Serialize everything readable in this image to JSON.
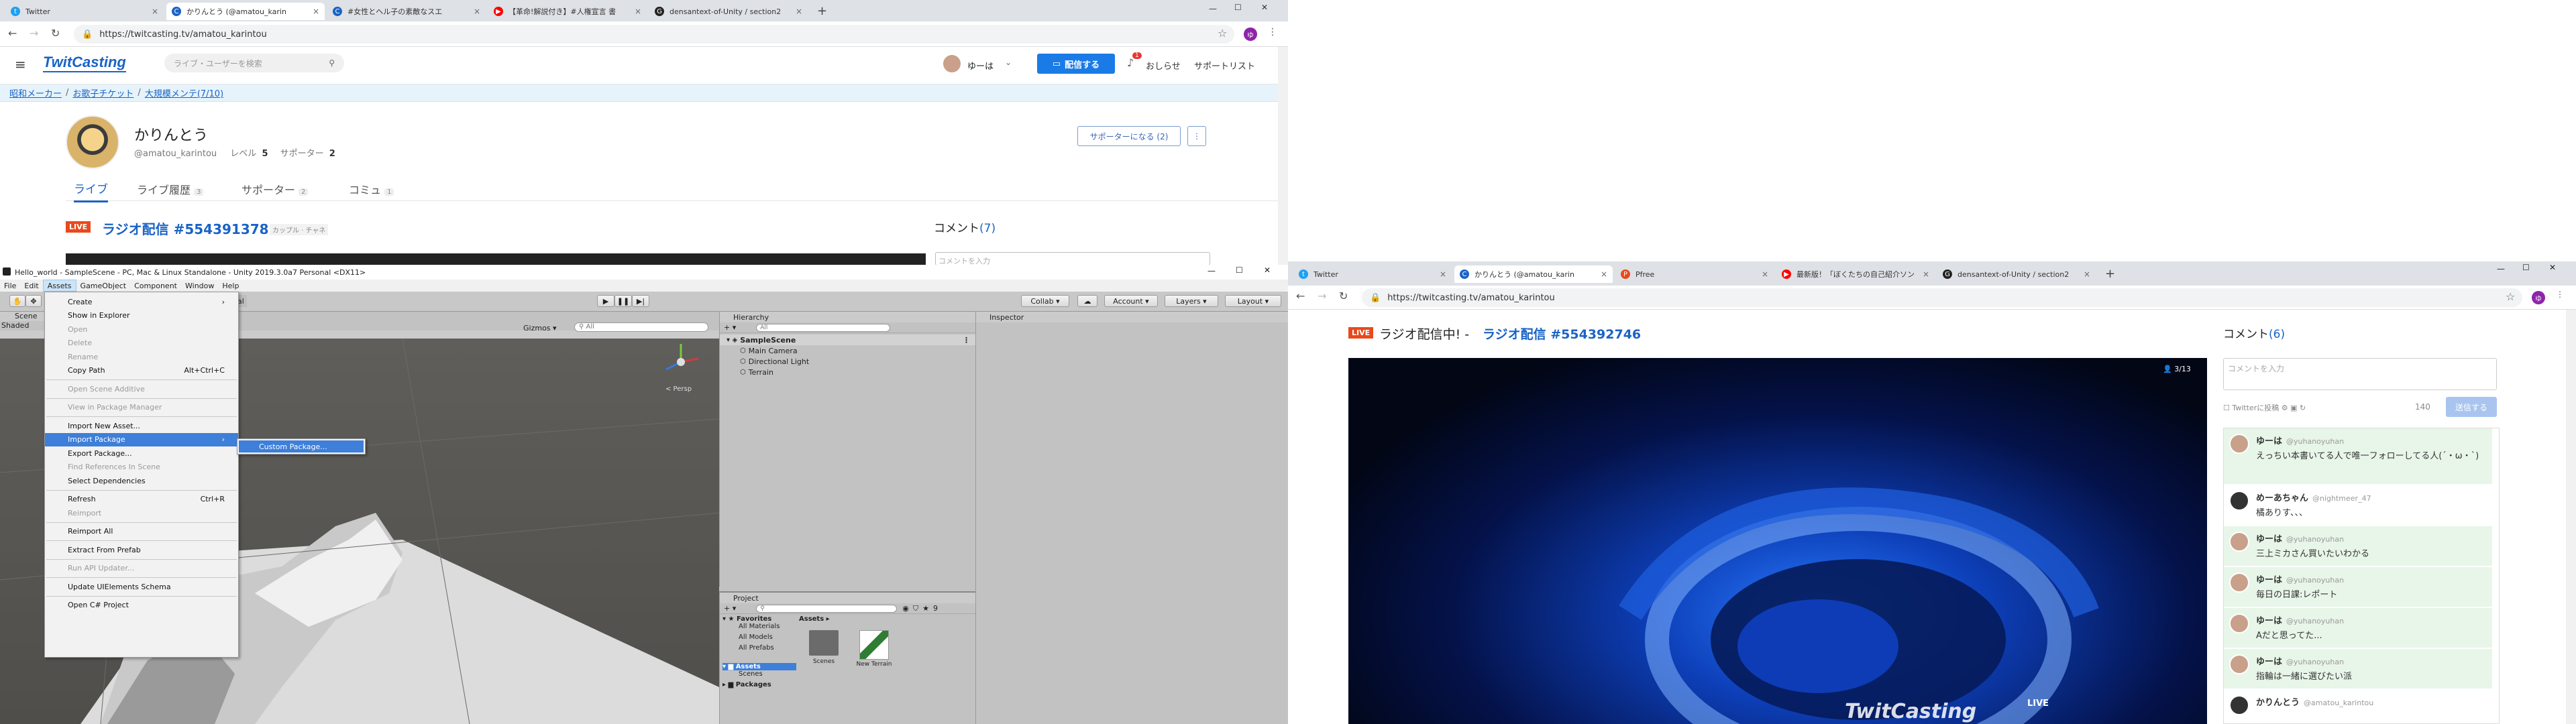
{
  "left_browser": {
    "tabs": [
      {
        "label": "Twitter",
        "icon": "twitter-icon"
      },
      {
        "label": "かりんとう (@amatou_karin",
        "icon": "twitcasting-icon"
      },
      {
        "label": "#女性とヘル子の素敵なスエ",
        "icon": "twitcasting-icon"
      },
      {
        "label": "【革命!解説付き】#人権宣言 書",
        "icon": "youtube-icon"
      },
      {
        "label": "densantext-of-Unity / section2",
        "icon": "github-icon"
      }
    ],
    "url": "https://twitcasting.tv/amatou_karintou",
    "site": {
      "logo": "TwitCasting",
      "search_placeholder": "ライブ・ユーザーを検索",
      "user_name": "ゆーは",
      "broadcast_button": "配信する",
      "notifications_label": "おしらせ",
      "notification_count": "1",
      "supporter_list": "サポートリスト",
      "banner": [
        "昭和メーカー",
        "お歌子チケット",
        "大規模メンテ(7/10)"
      ],
      "profile_name": "かりんとう",
      "profile_handle": "@amatou_karintou",
      "level_label": "レベル",
      "level_value": "5",
      "supporter_label": "サポーター",
      "supporter_value": "2",
      "become_supporter": "サポーターになる (2)",
      "tabs": [
        {
          "label": "ライブ",
          "count": ""
        },
        {
          "label": "ライブ履歴",
          "count": "3"
        },
        {
          "label": "サポーター",
          "count": "2"
        },
        {
          "label": "コミュ",
          "count": "1"
        }
      ],
      "live_badge": "LIVE",
      "live_title": "ラジオ配信 #554391378",
      "live_tags": "カップル · チャネ",
      "comment_header": "コメント",
      "comment_count": "(7)",
      "comment_placeholder": "コメントを入力"
    }
  },
  "unity": {
    "title": "Hello_world - SampleScene - PC, Mac & Linux Standalone - Unity 2019.3.0a7 Personal <DX11>",
    "menubar": [
      "File",
      "Edit",
      "Assets",
      "GameObject",
      "Component",
      "Window",
      "Help"
    ],
    "assets_menu": [
      {
        "label": "Create",
        "shortcut": "",
        "disabled": false,
        "submenu": true
      },
      {
        "label": "Show in Explorer",
        "shortcut": "",
        "disabled": false
      },
      {
        "label": "Open",
        "shortcut": "",
        "disabled": true
      },
      {
        "label": "Delete",
        "shortcut": "",
        "disabled": true
      },
      {
        "label": "Rename",
        "shortcut": "",
        "disabled": true
      },
      {
        "label": "Copy Path",
        "shortcut": "Alt+Ctrl+C",
        "disabled": false
      },
      {
        "sep": true
      },
      {
        "label": "Open Scene Additive",
        "shortcut": "",
        "disabled": true
      },
      {
        "sep": true
      },
      {
        "label": "View in Package Manager",
        "shortcut": "",
        "disabled": true
      },
      {
        "sep": true
      },
      {
        "label": "Import New Asset...",
        "shortcut": "",
        "disabled": false
      },
      {
        "label": "Import Package",
        "shortcut": "",
        "disabled": false,
        "submenu": true,
        "highlighted": true
      },
      {
        "label": "Export Package...",
        "shortcut": "",
        "disabled": false
      },
      {
        "label": "Find References In Scene",
        "shortcut": "",
        "disabled": true
      },
      {
        "label": "Select Dependencies",
        "shortcut": "",
        "disabled": false
      },
      {
        "sep": true
      },
      {
        "label": "Refresh",
        "shortcut": "Ctrl+R",
        "disabled": false
      },
      {
        "label": "Reimport",
        "shortcut": "",
        "disabled": true
      },
      {
        "sep": true
      },
      {
        "label": "Reimport All",
        "shortcut": "",
        "disabled": false
      },
      {
        "sep": true
      },
      {
        "label": "Extract From Prefab",
        "shortcut": "",
        "disabled": false
      },
      {
        "sep": true
      },
      {
        "label": "Run API Updater...",
        "shortcut": "",
        "disabled": true
      },
      {
        "sep": true
      },
      {
        "label": "Update UIElements Schema",
        "shortcut": "",
        "disabled": false
      },
      {
        "sep": true
      },
      {
        "label": "Open C# Project",
        "shortcut": "",
        "disabled": false
      }
    ],
    "submenu_item": "Custom Package...",
    "scene_tab": "Scene",
    "shaded": "Shaded",
    "gizmos": "Gizmos",
    "persp": "< Persp",
    "collab": "Collab",
    "account": "Account",
    "layers": "Layers",
    "layout": "Layout",
    "hierarchy_tab": "Hierarchy",
    "hierarchy_search": "All",
    "hierarchy": [
      {
        "label": "SampleScene",
        "indent": 0,
        "scene": true
      },
      {
        "label": "Main Camera",
        "indent": 1
      },
      {
        "label": "Directional Light",
        "indent": 1
      },
      {
        "label": "Terrain",
        "indent": 1
      }
    ],
    "inspector_tab": "Inspector",
    "project_tab": "Project",
    "favorites": "Favorites",
    "favorites_items": [
      "All Materials",
      "All Models",
      "All Prefabs"
    ],
    "assets_root": "Assets",
    "assets_children": [
      "Scenes",
      "Packages"
    ],
    "assets_breadcrumb": "Assets",
    "asset_items": [
      {
        "label": "Scenes",
        "icon": "folder-icon"
      },
      {
        "label": "New Terrain",
        "icon": "terrain-icon"
      }
    ],
    "counter": "9",
    "game_tab": "al"
  },
  "right_browser": {
    "tabs": [
      {
        "label": "Twitter",
        "icon": "twitter-icon"
      },
      {
        "label": "かりんとう (@amatou_karin",
        "icon": "twitcasting-icon"
      },
      {
        "label": "Pfree",
        "icon": "pfree-icon"
      },
      {
        "label": "最新版！「ぼくたちの自己紹介ソン",
        "icon": "youtube-icon"
      },
      {
        "label": "densantext-of-Unity / section2",
        "icon": "github-icon"
      }
    ],
    "url": "https://twitcasting.tv/amatou_karintou",
    "live_badge": "LIVE",
    "live_prefix": "ラジオ配信中! -",
    "live_title": "ラジオ配信 #554392746",
    "viewer_count": "3/13",
    "comment_header": "コメント",
    "comment_count": "(6)",
    "comment_placeholder": "コメントを入力",
    "twitter_post": "Twitterに投稿",
    "char_count": "140",
    "submit": "送信する",
    "video_watermark": "TwitCasting",
    "video_live": "LIVE",
    "comments": [
      {
        "name": "ゆーは",
        "handle": "@yuhanoyuhan",
        "text": "えっちい本書いてる人で唯一フォローしてる人(´・ω・`)",
        "green": true
      },
      {
        "name": "めーあちゃん",
        "handle": "@nightmeer_47",
        "text": "橘ありす、、、",
        "green": false
      },
      {
        "name": "ゆーは",
        "handle": "@yuhanoyuhan",
        "text": "三上ミカさん買いたいわかる",
        "green": true
      },
      {
        "name": "ゆーは",
        "handle": "@yuhanoyuhan",
        "text": "毎日の日課:レポート",
        "green": true
      },
      {
        "name": "ゆーは",
        "handle": "@yuhanoyuhan",
        "text": "Aだと思ってた...",
        "green": true
      },
      {
        "name": "ゆーは",
        "handle": "@yuhanoyuhan",
        "text": "指輪は一緒に選びたい派",
        "green": true
      },
      {
        "name": "かりんとう",
        "handle": "@amatou_karintou",
        "text": "",
        "green": false
      }
    ]
  },
  "colors": {
    "twitcasting_blue": "#1a63c6",
    "live_red": "#e8491d",
    "comment_green": "#e8f5e9",
    "unity_gray": "#c2c2c2",
    "menu_highlight": "#3d7fd9"
  }
}
